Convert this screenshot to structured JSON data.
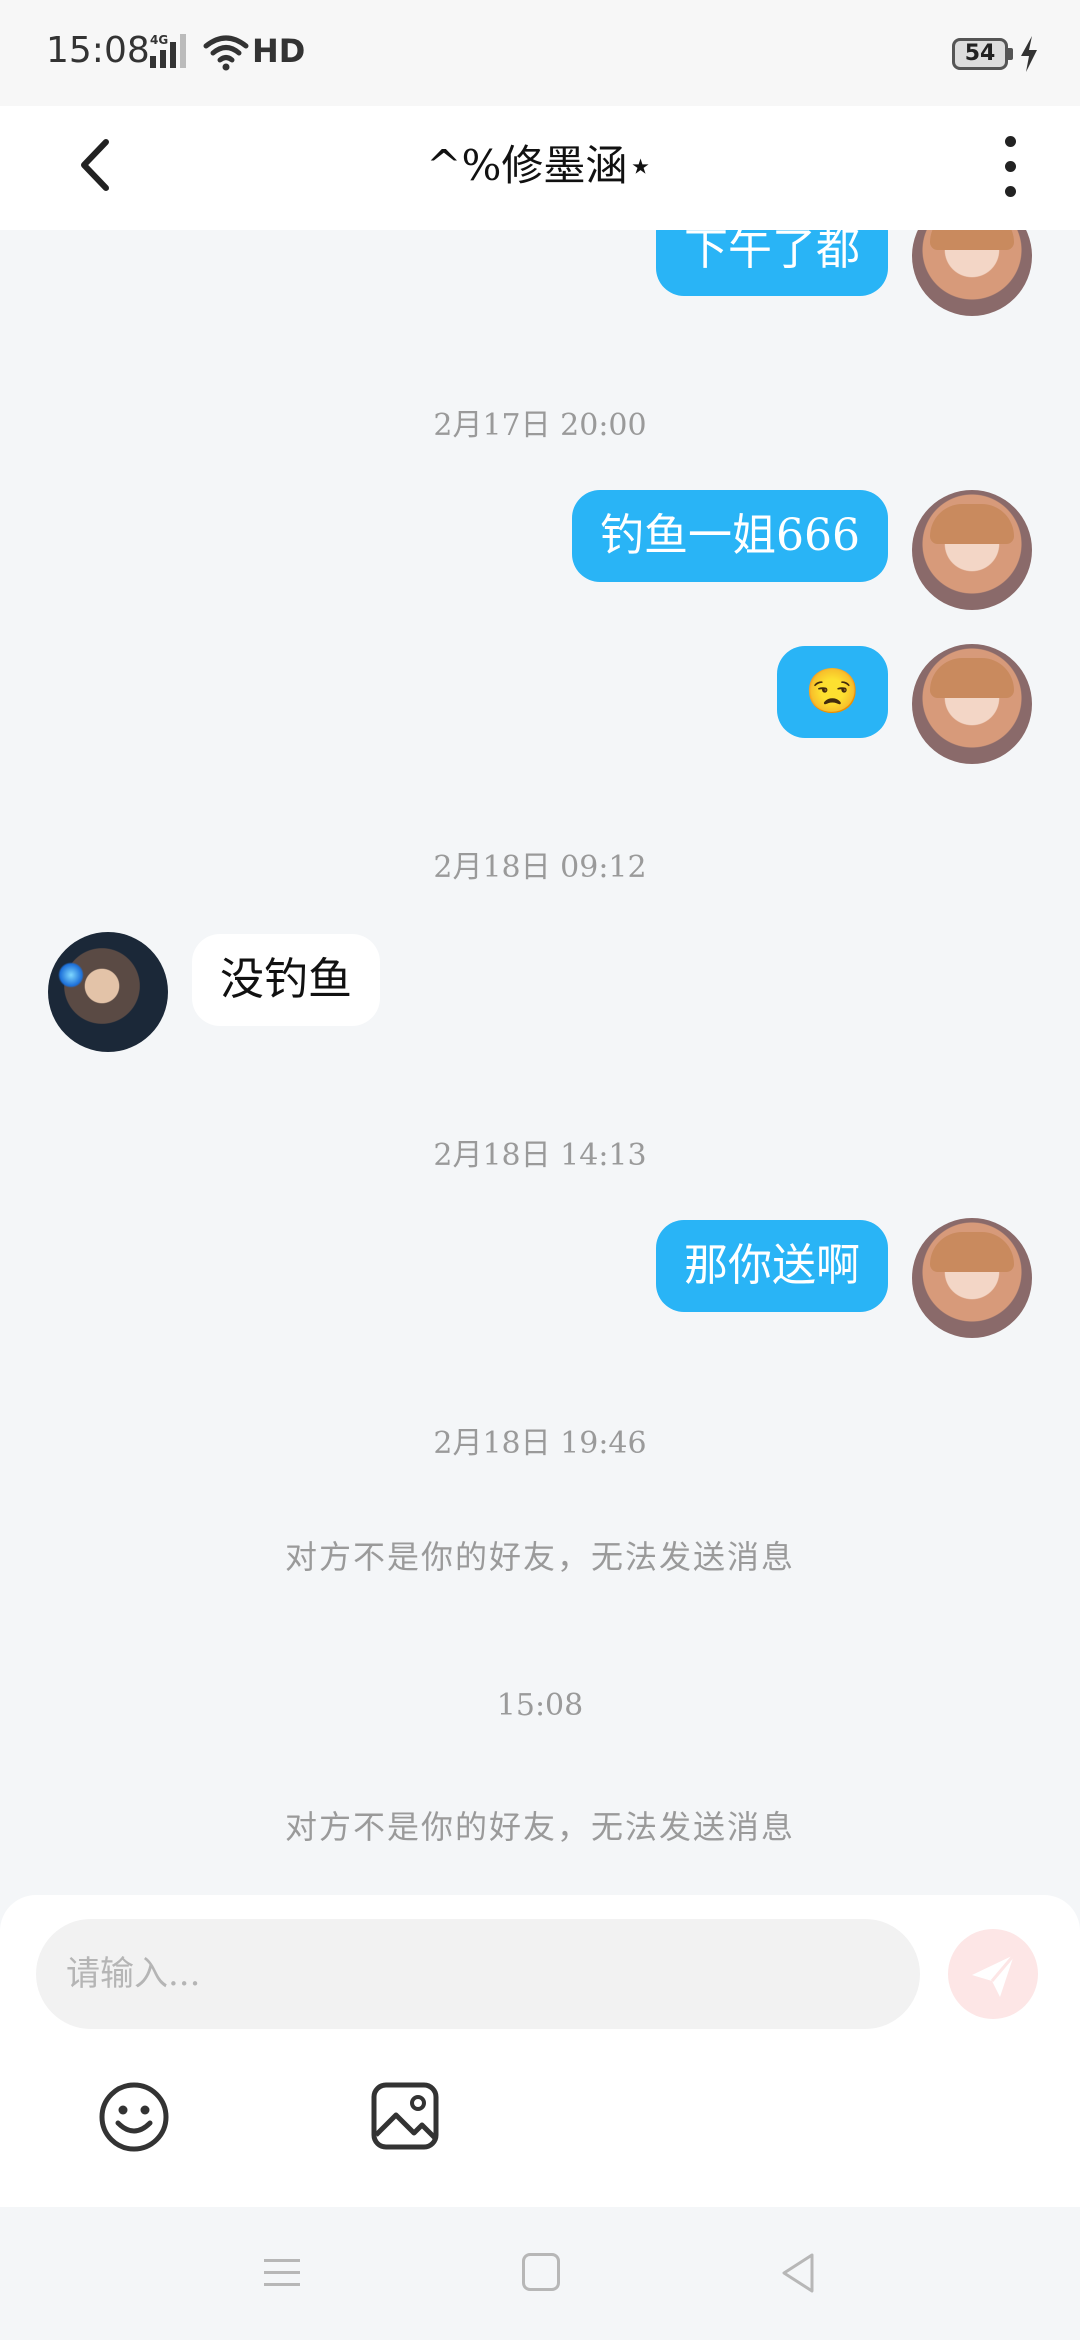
{
  "status_bar": {
    "time": "15:08",
    "network": "4G",
    "hd_label": "HD",
    "battery": "54"
  },
  "header": {
    "title": "^%修墨涵⋆"
  },
  "messages": [
    {
      "type": "outgoing",
      "text": "下午了都"
    },
    {
      "type": "timestamp",
      "text": "2月17日 20:00"
    },
    {
      "type": "outgoing",
      "text": "钓鱼一姐666"
    },
    {
      "type": "outgoing",
      "text": "😒"
    },
    {
      "type": "timestamp",
      "text": "2月18日 09:12"
    },
    {
      "type": "incoming",
      "text": "没钓鱼"
    },
    {
      "type": "timestamp",
      "text": "2月18日 14:13"
    },
    {
      "type": "outgoing",
      "text": "那你送啊"
    },
    {
      "type": "timestamp",
      "text": "2月18日 19:46"
    },
    {
      "type": "system",
      "text": "对方不是你的好友，无法发送消息"
    },
    {
      "type": "timestamp",
      "text": "15:08"
    },
    {
      "type": "system",
      "text": "对方不是你的好友，无法发送消息"
    }
  ],
  "composer": {
    "placeholder": "请输入...",
    "value": ""
  },
  "colors": {
    "outgoing_bubble": "#29b4f6",
    "incoming_bubble": "#ffffff",
    "chat_background": "#f4f6f8",
    "send_button": "#fde6e6"
  },
  "icons": [
    "back-arrow-icon",
    "more-vertical-icon",
    "send-icon",
    "emoji-icon",
    "image-icon",
    "nav-menu-icon",
    "nav-home-icon",
    "nav-back-icon"
  ]
}
